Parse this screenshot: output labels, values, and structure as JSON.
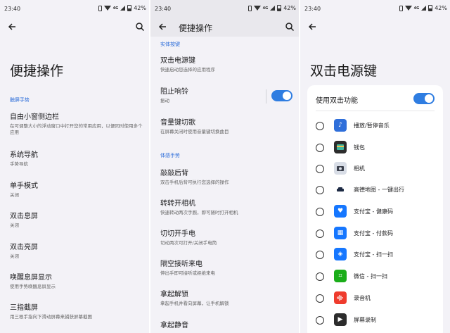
{
  "panel1": {
    "status": {
      "time": "23:40",
      "network": "4G",
      "battery": "42%"
    },
    "title": "便捷操作",
    "section": "触屏手势",
    "items": [
      {
        "title": "自由小窗侧边栏",
        "subtitle": "在可调整大小的浮动窗口中打开您的常用应用，以便同时使用多个应用"
      },
      {
        "title": "系统导航",
        "subtitle": "手势导航"
      },
      {
        "title": "单手模式",
        "subtitle": "关闭"
      },
      {
        "title": "双击息屏",
        "subtitle": "关闭"
      },
      {
        "title": "双击亮屏",
        "subtitle": "关闭"
      },
      {
        "title": "唤醒息屏显示",
        "subtitle": "使用手势唤醒息屏显示"
      },
      {
        "title": "三指截屏",
        "subtitle": "用三根手指向下滑动屏幕来捕获屏幕截图"
      }
    ]
  },
  "panel2": {
    "status": {
      "time": "23:40",
      "network": "4G",
      "battery": "42%"
    },
    "title": "便捷操作",
    "section1": "实体按键",
    "section2": "体感手势",
    "items": [
      {
        "title": "双击电源键",
        "subtitle": "快速启动您选择的应用程序"
      },
      {
        "title": "阻止响铃",
        "subtitle": "振动"
      },
      {
        "title": "音量键切歌",
        "subtitle": "在屏幕关闭时使用音量键切换曲目"
      },
      {
        "title": "敲敲后背",
        "subtitle": "双击手机后背可执行您选择的操作"
      },
      {
        "title": "转转开相机",
        "subtitle": "快速转动两次手腕，即可随时打开相机"
      },
      {
        "title": "切切开手电",
        "subtitle": "切动两次可打开/关闭手电筒"
      },
      {
        "title": "隔空接听来电",
        "subtitle": "伸出手即可接听或拒绝来电"
      },
      {
        "title": "拿起解锁",
        "subtitle": "拿起手机并看向屏幕，让手机解锁"
      },
      {
        "title": "拿起静音",
        "subtitle": ""
      }
    ],
    "toggle_on": true
  },
  "panel3": {
    "status": {
      "time": "23:40",
      "network": "4G",
      "battery": "42%"
    },
    "title": "双击电源键",
    "card_heading": "使用双击功能",
    "toggle_on": true,
    "options": [
      {
        "label": "播放/暂停音乐",
        "icon": "music-icon",
        "color": "#2f6fda"
      },
      {
        "label": "钱包",
        "icon": "wallet-icon",
        "color": "#2c2c2c"
      },
      {
        "label": "相机",
        "icon": "camera-icon",
        "color": "#d8dde6"
      },
      {
        "label": "高德地图 - 一键出行",
        "icon": "car-icon",
        "color": "#ffffff"
      },
      {
        "label": "支付宝 - 健康码",
        "icon": "health-code-icon",
        "color": "#1677ff"
      },
      {
        "label": "支付宝 - 付款码",
        "icon": "pay-code-icon",
        "color": "#1677ff"
      },
      {
        "label": "支付宝 - 扫一扫",
        "icon": "scan-icon",
        "color": "#1677ff"
      },
      {
        "label": "微信 - 扫一扫",
        "icon": "wechat-scan-icon",
        "color": "#1aad19"
      },
      {
        "label": "录音机",
        "icon": "recorder-icon",
        "color": "#ef3b2d"
      },
      {
        "label": "屏幕录制",
        "icon": "screen-record-icon",
        "color": "#2c2c2c"
      }
    ]
  },
  "colors": {
    "accent": "#2f7de1",
    "background": "#f3f2f7"
  }
}
